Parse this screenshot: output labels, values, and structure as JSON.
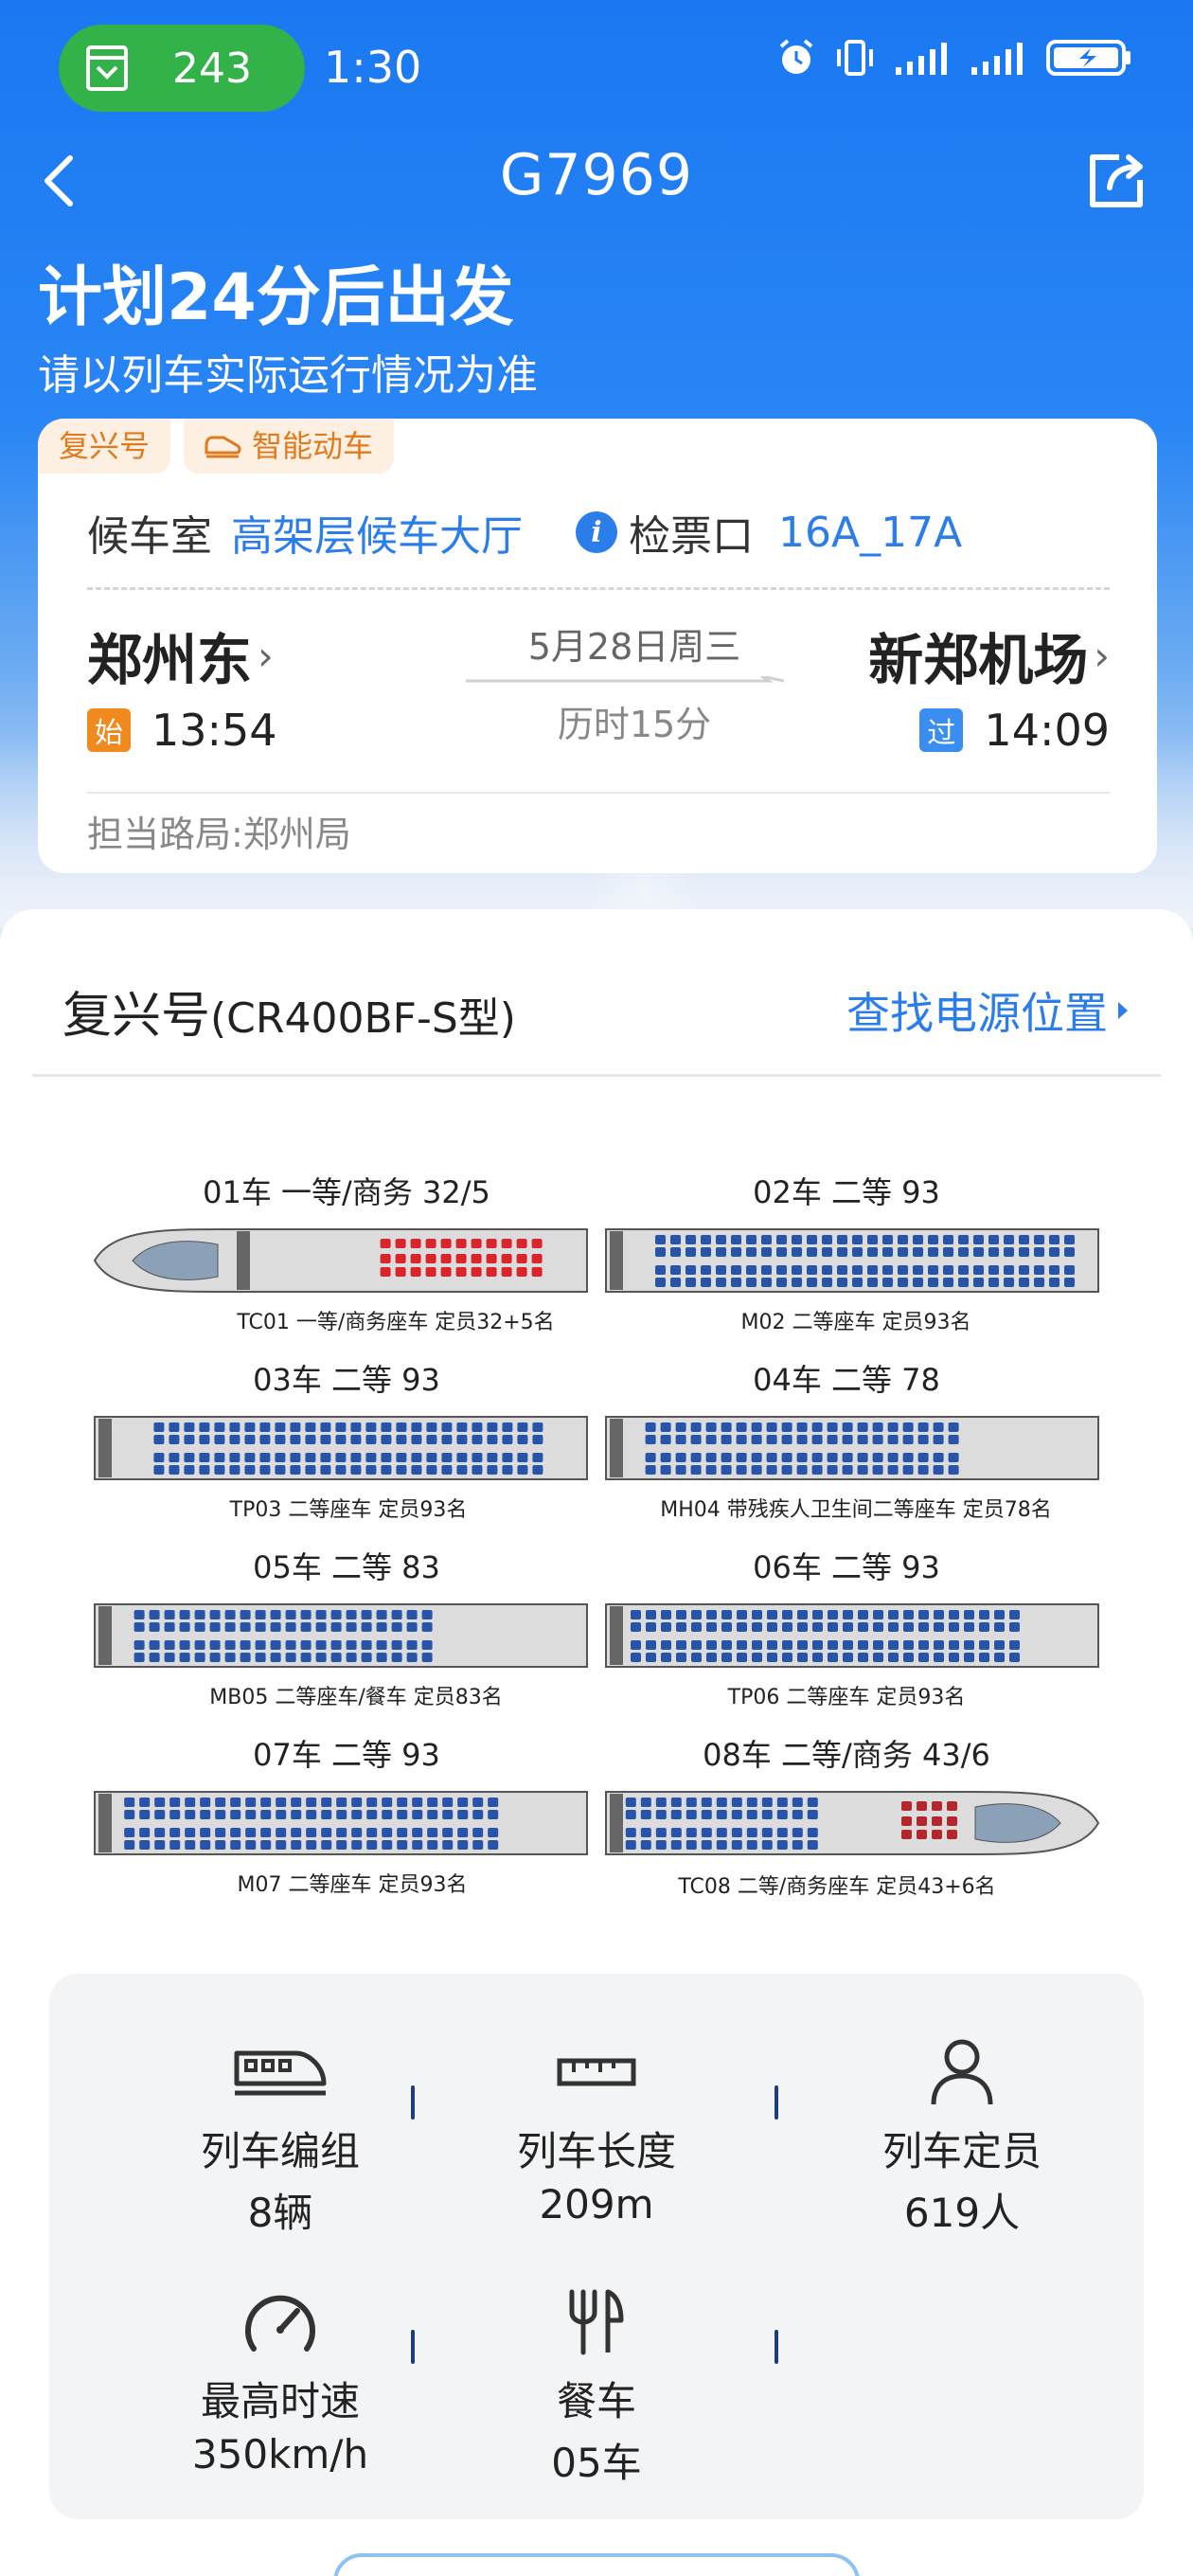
{
  "status_bar": {
    "pill_count": "243",
    "time": "1:30"
  },
  "nav": {
    "train_no": "G7969"
  },
  "header": {
    "depart_text": "计划24分后出发",
    "notice": "请以列车实际运行情况为准"
  },
  "card": {
    "tags": [
      "复兴号",
      "智能动车"
    ],
    "waiting_room_label": "候车室",
    "waiting_room_value": "高架层候车大厅",
    "gate_label": "检票口",
    "gate_value": "16A_17A",
    "from_station": "郑州东",
    "to_station": "新郑机场",
    "date": "5月28日周三",
    "duration": "历时15分",
    "from_badge": "始",
    "from_time": "13:54",
    "to_badge": "过",
    "to_time": "14:09",
    "bureau": "担当路局:郑州局"
  },
  "train": {
    "model_name": "复兴号",
    "model_type": "(CR400BF-S型)",
    "power_link": "查找电源位置",
    "cars": [
      {
        "label": "01车 一等/商务 32/5",
        "caption": "TC01 一等/商务座车 定员32+5名"
      },
      {
        "label": "02车 二等 93",
        "caption": "M02 二等座车 定员93名"
      },
      {
        "label": "03车 二等 93",
        "caption": "TP03 二等座车 定员93名"
      },
      {
        "label": "04车 二等 78",
        "caption": "MH04 带残疾人卫生间二等座车 定员78名"
      },
      {
        "label": "05车 二等 83",
        "caption": "MB05 二等座车/餐车 定员83名"
      },
      {
        "label": "06车 二等 93",
        "caption": "TP06 二等座车 定员93名"
      },
      {
        "label": "07车 二等 93",
        "caption": "M07 二等座车 定员93名"
      },
      {
        "label": "08车 二等/商务 43/6",
        "caption": "TC08 二等/商务座车 定员43+6名"
      }
    ]
  },
  "stats": {
    "composition_label": "列车编组",
    "composition_value": "8辆",
    "length_label": "列车长度",
    "length_value": "209m",
    "capacity_label": "列车定员",
    "capacity_value": "619人",
    "speed_label": "最高时速",
    "speed_value": "350km/h",
    "dining_label": "餐车",
    "dining_value": "05车"
  },
  "icons": {
    "pill": "ticket-gate-icon",
    "back": "back-arrow-icon",
    "share": "share-icon",
    "info": "info-icon",
    "power": "chevron-right-icon",
    "composition": "train-icon",
    "length": "ruler-icon",
    "capacity": "person-icon",
    "speed": "speedometer-icon",
    "dining": "fork-knife-icon"
  },
  "colors": {
    "primary": "#1a78f2",
    "link": "#2b7de9",
    "tag_text": "#e07a1c",
    "pill_green": "#34b24a"
  }
}
